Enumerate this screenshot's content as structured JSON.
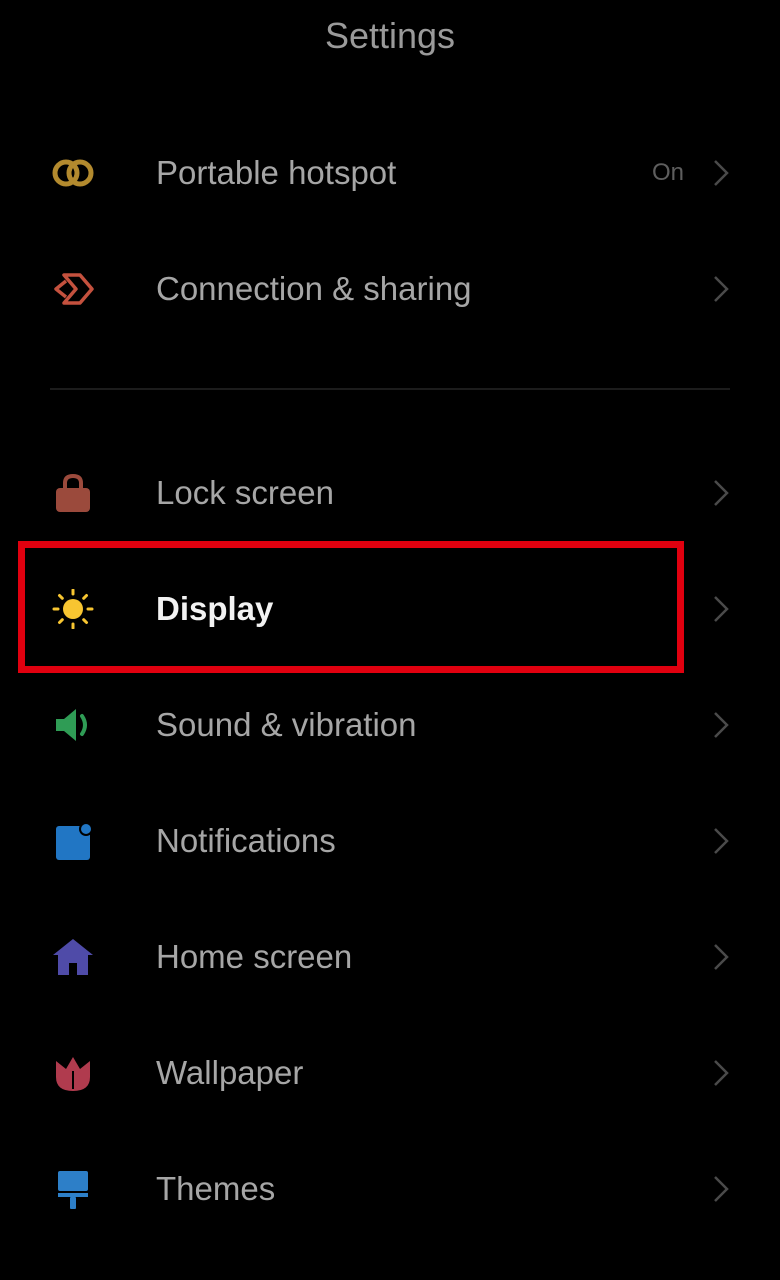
{
  "header": {
    "title": "Settings"
  },
  "items": [
    {
      "id": "portable-hotspot",
      "label": "Portable hotspot",
      "value": "On",
      "icon": "hotspot-icon",
      "icon_color": "#b38a2e"
    },
    {
      "id": "connection-sharing",
      "label": "Connection & sharing",
      "value": "",
      "icon": "connection-sharing-icon",
      "icon_color": "#c4513e"
    },
    {
      "id": "lock-screen",
      "label": "Lock screen",
      "value": "",
      "icon": "lock-icon",
      "icon_color": "#9b4a3c"
    },
    {
      "id": "display",
      "label": "Display",
      "value": "",
      "icon": "sun-icon",
      "icon_color": "#f7c531",
      "highlighted": true
    },
    {
      "id": "sound-vibration",
      "label": "Sound & vibration",
      "value": "",
      "icon": "speaker-icon",
      "icon_color": "#2f9c55"
    },
    {
      "id": "notifications",
      "label": "Notifications",
      "value": "",
      "icon": "notification-icon",
      "icon_color": "#2176c4"
    },
    {
      "id": "home-screen",
      "label": "Home screen",
      "value": "",
      "icon": "home-icon",
      "icon_color": "#4f4ba8"
    },
    {
      "id": "wallpaper",
      "label": "Wallpaper",
      "value": "",
      "icon": "tulip-icon",
      "icon_color": "#b03b4e"
    },
    {
      "id": "themes",
      "label": "Themes",
      "value": "",
      "icon": "paint-roller-icon",
      "icon_color": "#2d7fc8"
    }
  ],
  "colors": {
    "background": "#000000",
    "highlight_border": "#e0000f",
    "chevron": "#4a4a4a"
  }
}
